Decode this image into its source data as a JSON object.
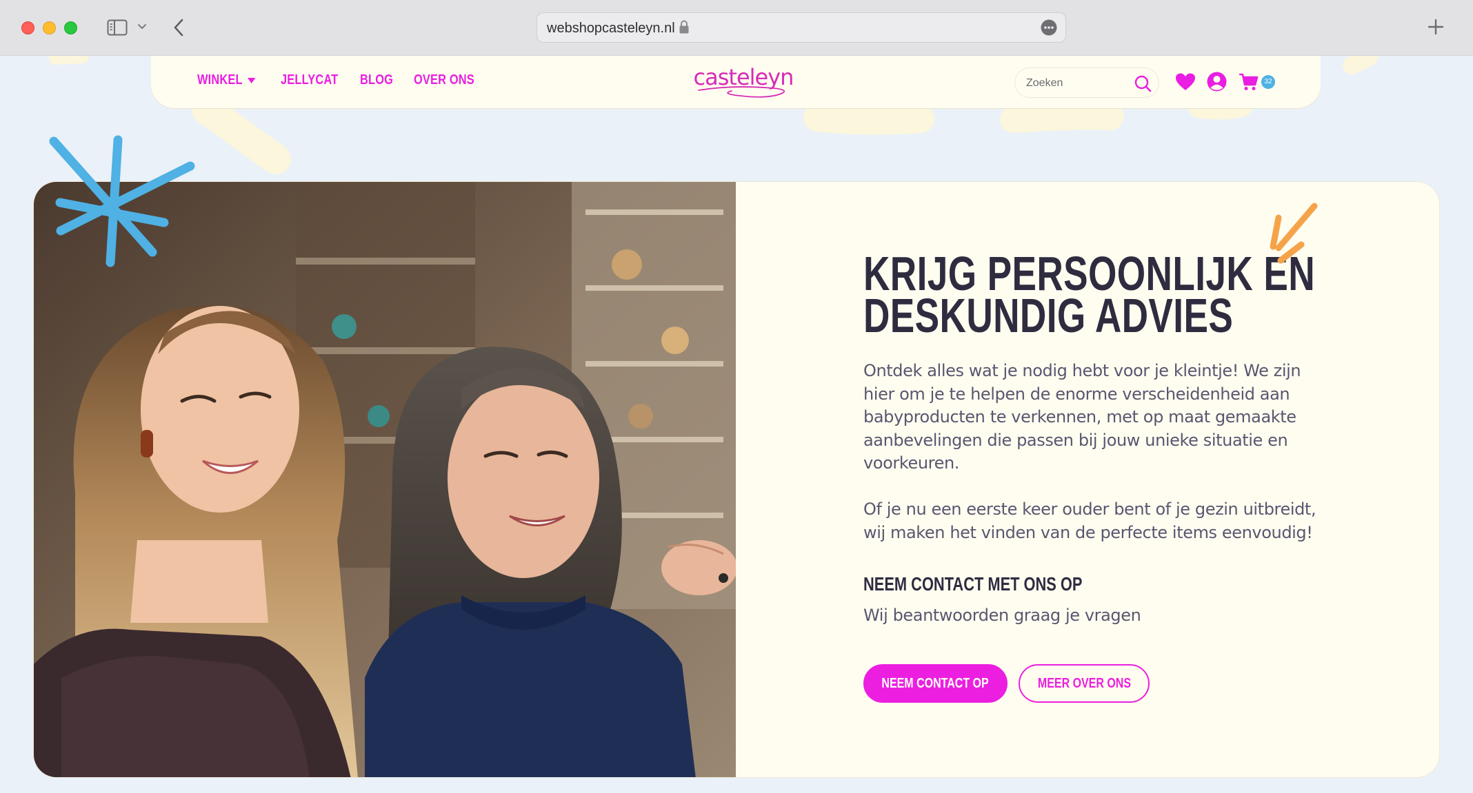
{
  "browser": {
    "url": "webshopcasteleyn.nl"
  },
  "nav": {
    "items": [
      {
        "label": "WINKEL",
        "has_dropdown": true
      },
      {
        "label": "JELLYCAT"
      },
      {
        "label": "BLOG"
      },
      {
        "label": "OVER ONS"
      }
    ],
    "logo_text": "casteleyn",
    "search_placeholder": "Zoeken",
    "cart_count": "32"
  },
  "hero": {
    "title_line1": "KRIJG PERSOONLIJK EN",
    "title_line2": "DESKUNDIG ADVIES",
    "paragraph1": "Ontdek alles wat je nodig hebt voor je kleintje! We zijn hier om je te helpen de enorme verscheidenheid aan babyproducten te verkennen, met op maat gemaakte aanbevelingen die passen bij jouw unieke situatie en voorkeuren.",
    "paragraph2": "Of je nu een eerste keer ouder bent of je gezin uitbreidt, wij maken het vinden van de perfecte items eenvoudig!",
    "contact_heading": "NEEM CONTACT MET ONS OP",
    "contact_sub": "Wij beantwoorden graag je vragen",
    "primary_button": "NEEM CONTACT OP",
    "secondary_button": "MEER OVER ONS"
  },
  "colors": {
    "brand_pink": "#ec1fe0",
    "heading_dark": "#2f2c40",
    "body_text": "#5a5670",
    "cream": "#fffdf0",
    "page_bg": "#eaf1f8",
    "accent_blue": "#4fb1e4",
    "accent_orange": "#f5a34a"
  }
}
